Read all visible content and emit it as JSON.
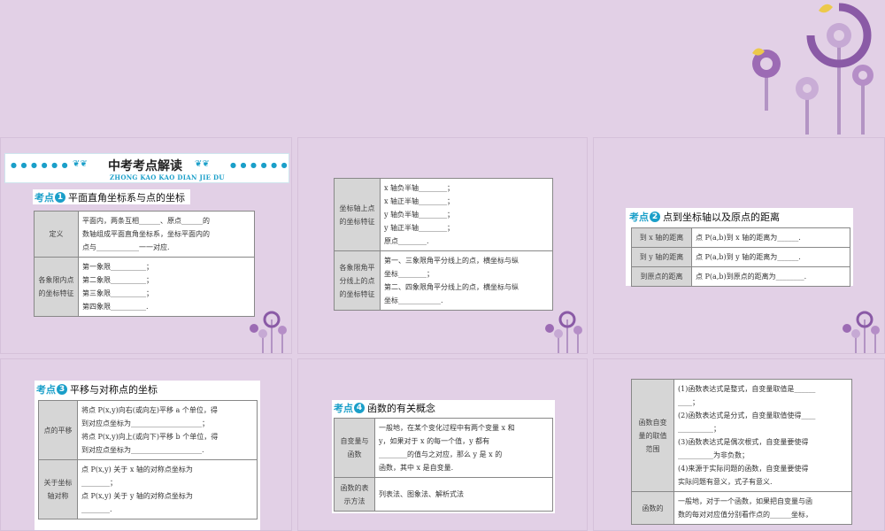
{
  "banner": {
    "dots": "● ● ● ● ● ●",
    "title": "中考考点解读",
    "subtitle": "ZHONG KAO KAO DIAN JIE DU"
  },
  "point1": {
    "tag": "考点",
    "num": "1",
    "title": "平面直角坐标系与点的坐标",
    "rows": [
      {
        "head": "定义",
        "lines": [
          "平面内，两条互相______、原点______的",
          "数轴组成平面直角坐标系，坐标平面内的",
          "点与____________一一对应."
        ]
      },
      {
        "head": "各象限内点的坐标特征",
        "lines": [
          "第一象限__________；",
          "第二象限__________；",
          "第三象限__________；",
          "第四象限__________."
        ]
      }
    ]
  },
  "point1b": {
    "rows": [
      {
        "head": "坐标轴上点的坐标特征",
        "lines": [
          "x 轴负半轴________；",
          "x 轴正半轴________；",
          "y 轴负半轴________；",
          "y 轴正半轴________；",
          "原点________."
        ]
      },
      {
        "head": "各象限角平分线上的点的坐标特征",
        "lines": [
          "第一、三象限角平分线上的点，横坐标与纵",
          "坐标________；",
          "第二、四象限角平分线上的点，横坐标与纵",
          "坐标____________."
        ]
      }
    ]
  },
  "point2": {
    "tag": "考点",
    "num": "2",
    "title": "点到坐标轴以及原点的距离",
    "rows": [
      {
        "head": "到 x 轴的距离",
        "text": "点 P(a,b)到 x 轴的距离为______."
      },
      {
        "head": "到 y 轴的距离",
        "text": "点 P(a,b)到 y 轴的距离为______."
      },
      {
        "head": "到原点的距离",
        "text": "点 P(a,b)到原点的距离为________."
      }
    ]
  },
  "point3": {
    "tag": "考点",
    "num": "3",
    "title": "平移与对称点的坐标",
    "rows": [
      {
        "head": "点的平移",
        "lines": [
          "将点 P(x,y)向右(或向左)平移 a 个单位，得",
          "到对应点坐标为____________________；",
          "将点 P(x,y)向上(或向下)平移 b 个单位，得",
          "到对应点坐标为____________________."
        ]
      },
      {
        "head": "关于坐标轴对称",
        "lines": [
          "点 P(x,y) 关于 x 轴的对称点坐标为",
          "________；",
          "点 P(x,y) 关于 y 轴的对称点坐标为",
          "________."
        ]
      }
    ]
  },
  "point4": {
    "tag": "考点",
    "num": "4",
    "title": "函数的有关概念",
    "rows": [
      {
        "head": "自变量与函数",
        "lines": [
          "一般地，在某个变化过程中有两个变量 x 和",
          "y，如果对于 x 的每一个值，y 都有",
          "________的值与之对应，那么 y 是 x 的",
          "函数，其中 x 是自变量."
        ]
      },
      {
        "head": "函数的表示方法",
        "lines": [
          "列表法、图象法、解析式法"
        ]
      }
    ]
  },
  "point4b": {
    "rows": [
      {
        "head": "函数自变量的取值范围",
        "lines": [
          "(1)函数表达式是整式，自变量取值是______",
          "____；",
          "(2)函数表达式是分式，自变量取值使得____",
          "__________；",
          "(3)函数表达式是偶次根式，自变量要使得",
          "__________为非负数；",
          "(4)来源于实际问题的函数，自变量要使得",
          "实际问题有意义，式子有意义."
        ]
      },
      {
        "head": "函数的",
        "lines": [
          "一般地，对于一个函数，如果把自变量与函",
          "数的每对对应值分别看作点的______坐标，"
        ]
      }
    ]
  }
}
